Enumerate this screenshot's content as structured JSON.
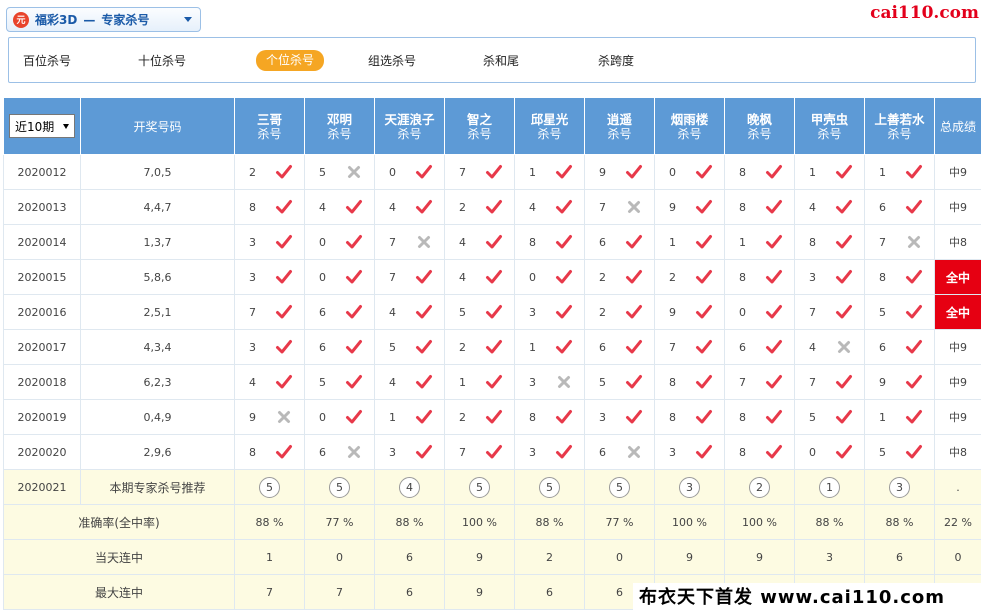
{
  "header": {
    "lottery_label": "福彩3D",
    "separator": "—",
    "section_label": "专家杀号",
    "brand": "cai110.com",
    "logo_char": "元"
  },
  "tabs": [
    {
      "label": "百位杀号",
      "active": false
    },
    {
      "label": "十位杀号",
      "active": false
    },
    {
      "label": "个位杀号",
      "active": true
    },
    {
      "label": "组选杀号",
      "active": false
    },
    {
      "label": "杀和尾",
      "active": false
    },
    {
      "label": "杀跨度",
      "active": false
    }
  ],
  "table": {
    "period_select": "近10期",
    "draw_header": "开奖号码",
    "total_header": "总成绩",
    "sub_label": "杀号",
    "experts": [
      "三哥",
      "邓明",
      "天涯浪子",
      "智之",
      "邱星光",
      "逍遥",
      "烟雨楼",
      "晚枫",
      "甲壳虫",
      "上善若水"
    ],
    "rows": [
      {
        "period": "2020012",
        "draw": "7,0,5",
        "kills": [
          [
            "2",
            "y"
          ],
          [
            "5",
            "n"
          ],
          [
            "0",
            "y"
          ],
          [
            "7",
            "y"
          ],
          [
            "1",
            "y"
          ],
          [
            "9",
            "y"
          ],
          [
            "0",
            "y"
          ],
          [
            "8",
            "y"
          ],
          [
            "1",
            "y"
          ],
          [
            "1",
            "y"
          ]
        ],
        "total": "中9"
      },
      {
        "period": "2020013",
        "draw": "4,4,7",
        "kills": [
          [
            "8",
            "y"
          ],
          [
            "4",
            "y"
          ],
          [
            "4",
            "y"
          ],
          [
            "2",
            "y"
          ],
          [
            "4",
            "y"
          ],
          [
            "7",
            "n"
          ],
          [
            "9",
            "y"
          ],
          [
            "8",
            "y"
          ],
          [
            "4",
            "y"
          ],
          [
            "6",
            "y"
          ]
        ],
        "total": "中9"
      },
      {
        "period": "2020014",
        "draw": "1,3,7",
        "kills": [
          [
            "3",
            "y"
          ],
          [
            "0",
            "y"
          ],
          [
            "7",
            "n"
          ],
          [
            "4",
            "y"
          ],
          [
            "8",
            "y"
          ],
          [
            "6",
            "y"
          ],
          [
            "1",
            "y"
          ],
          [
            "1",
            "y"
          ],
          [
            "8",
            "y"
          ],
          [
            "7",
            "n"
          ]
        ],
        "total": "中8"
      },
      {
        "period": "2020015",
        "draw": "5,8,6",
        "kills": [
          [
            "3",
            "y"
          ],
          [
            "0",
            "y"
          ],
          [
            "7",
            "y"
          ],
          [
            "4",
            "y"
          ],
          [
            "0",
            "y"
          ],
          [
            "2",
            "y"
          ],
          [
            "2",
            "y"
          ],
          [
            "8",
            "y"
          ],
          [
            "3",
            "y"
          ],
          [
            "8",
            "y"
          ]
        ],
        "total": "全中"
      },
      {
        "period": "2020016",
        "draw": "2,5,1",
        "kills": [
          [
            "7",
            "y"
          ],
          [
            "6",
            "y"
          ],
          [
            "4",
            "y"
          ],
          [
            "5",
            "y"
          ],
          [
            "3",
            "y"
          ],
          [
            "2",
            "y"
          ],
          [
            "9",
            "y"
          ],
          [
            "0",
            "y"
          ],
          [
            "7",
            "y"
          ],
          [
            "5",
            "y"
          ]
        ],
        "total": "全中"
      },
      {
        "period": "2020017",
        "draw": "4,3,4",
        "kills": [
          [
            "3",
            "y"
          ],
          [
            "6",
            "y"
          ],
          [
            "5",
            "y"
          ],
          [
            "2",
            "y"
          ],
          [
            "1",
            "y"
          ],
          [
            "6",
            "y"
          ],
          [
            "7",
            "y"
          ],
          [
            "6",
            "y"
          ],
          [
            "4",
            "n"
          ],
          [
            "6",
            "y"
          ]
        ],
        "total": "中9"
      },
      {
        "period": "2020018",
        "draw": "6,2,3",
        "kills": [
          [
            "4",
            "y"
          ],
          [
            "5",
            "y"
          ],
          [
            "4",
            "y"
          ],
          [
            "1",
            "y"
          ],
          [
            "3",
            "n"
          ],
          [
            "5",
            "y"
          ],
          [
            "8",
            "y"
          ],
          [
            "7",
            "y"
          ],
          [
            "7",
            "y"
          ],
          [
            "9",
            "y"
          ]
        ],
        "total": "中9"
      },
      {
        "period": "2020019",
        "draw": "0,4,9",
        "kills": [
          [
            "9",
            "n"
          ],
          [
            "0",
            "y"
          ],
          [
            "1",
            "y"
          ],
          [
            "2",
            "y"
          ],
          [
            "8",
            "y"
          ],
          [
            "3",
            "y"
          ],
          [
            "8",
            "y"
          ],
          [
            "8",
            "y"
          ],
          [
            "5",
            "y"
          ],
          [
            "1",
            "y"
          ]
        ],
        "total": "中9"
      },
      {
        "period": "2020020",
        "draw": "2,9,6",
        "kills": [
          [
            "8",
            "y"
          ],
          [
            "6",
            "n"
          ],
          [
            "3",
            "y"
          ],
          [
            "7",
            "y"
          ],
          [
            "3",
            "y"
          ],
          [
            "6",
            "n"
          ],
          [
            "3",
            "y"
          ],
          [
            "8",
            "y"
          ],
          [
            "0",
            "y"
          ],
          [
            "5",
            "y"
          ]
        ],
        "total": "中8"
      }
    ],
    "recommend": {
      "period": "2020021",
      "label": "本期专家杀号推荐",
      "values": [
        "5",
        "5",
        "4",
        "5",
        "5",
        "5",
        "3",
        "2",
        "1",
        "3"
      ],
      "total": "."
    },
    "stats": [
      {
        "label": "准确率(全中率)",
        "values": [
          "88 %",
          "77 %",
          "88 %",
          "100 %",
          "88 %",
          "77 %",
          "100 %",
          "100 %",
          "88 %",
          "88 %"
        ],
        "total": "22 %"
      },
      {
        "label": "当天连中",
        "values": [
          "1",
          "0",
          "6",
          "9",
          "2",
          "0",
          "9",
          "9",
          "3",
          "6"
        ],
        "total": "0"
      },
      {
        "label": "最大连中",
        "values": [
          "7",
          "7",
          "6",
          "9",
          "6",
          "6",
          "",
          "",
          "",
          ""
        ],
        "total": ""
      }
    ]
  },
  "footer_stamp": "布衣天下首发 www.cai110.com",
  "colors": {
    "header_blue": "#5d9ad6",
    "hit_red": "#e8394a",
    "miss_gray": "#b9b9b9",
    "allwin_red": "#e60012",
    "tab_active": "#f5a623"
  }
}
